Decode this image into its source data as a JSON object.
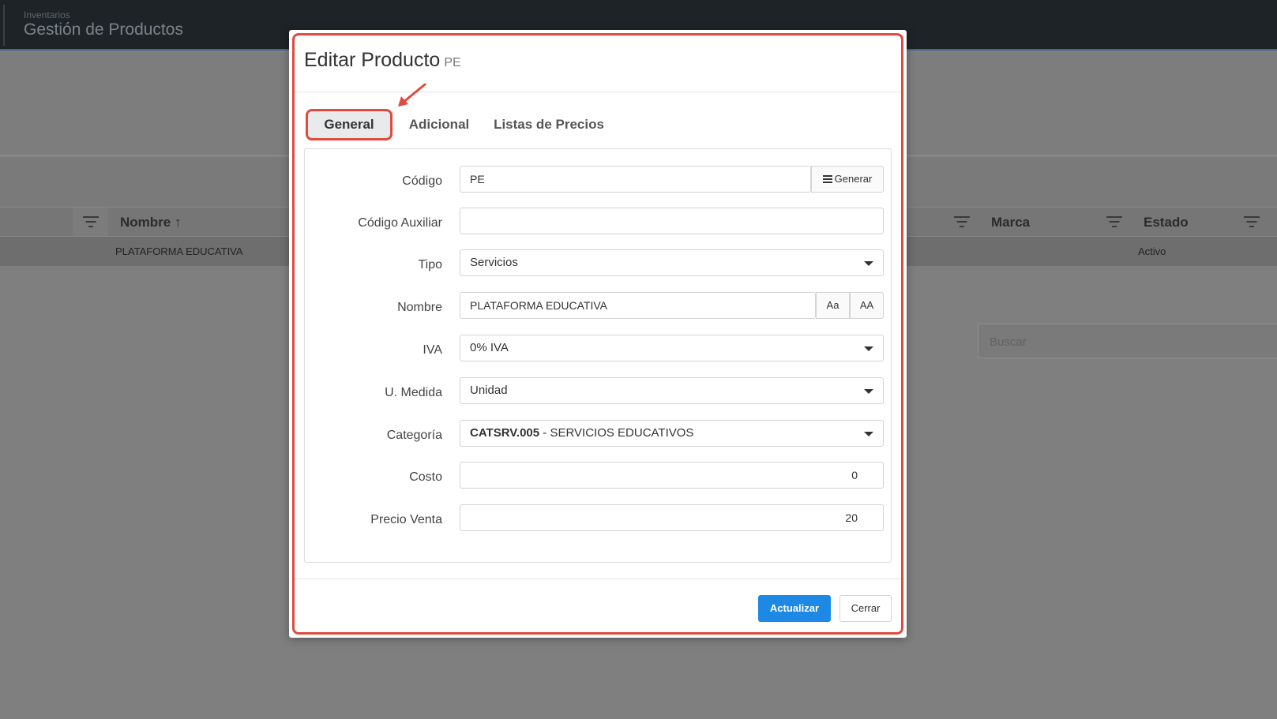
{
  "app": {
    "module": "Inventarios",
    "title": "Gestión de Productos"
  },
  "search": {
    "placeholder": "Buscar"
  },
  "grid": {
    "headers": {
      "nombre": "Nombre ↑",
      "marca": "Marca",
      "estado": "Estado"
    },
    "rows": [
      {
        "nombre": "PLATAFORMA EDUCATIVA",
        "estado": "Activo"
      }
    ]
  },
  "modal": {
    "title": "Editar Producto",
    "subtitle": "PE",
    "tabs": [
      "General",
      "Adicional",
      "Listas de Precios"
    ],
    "active_tab": "General",
    "fields": {
      "codigo": {
        "label": "Código",
        "value": "PE",
        "button": "Generar"
      },
      "codigo_auxiliar": {
        "label": "Código Auxiliar",
        "value": ""
      },
      "tipo": {
        "label": "Tipo",
        "value": "Servicios"
      },
      "nombre": {
        "label": "Nombre",
        "value": "PLATAFORMA EDUCATIVA",
        "btn_capitalize": "Aa",
        "btn_upper": "AA"
      },
      "iva": {
        "label": "IVA",
        "value": "0% IVA"
      },
      "medida": {
        "label": "U. Medida",
        "value": "Unidad"
      },
      "categoria": {
        "label": "Categoría",
        "code": "CATSRV.005",
        "separator": " - ",
        "name": "SERVICIOS EDUCATIVOS"
      },
      "costo": {
        "label": "Costo",
        "value": "0"
      },
      "precio_venta": {
        "label": "Precio Venta",
        "value": "20"
      }
    },
    "buttons": {
      "update": "Actualizar",
      "close": "Cerrar"
    }
  },
  "colors": {
    "primary": "#1e88e5",
    "annotation": "#e04a3f",
    "header_bg": "#1e2328"
  }
}
